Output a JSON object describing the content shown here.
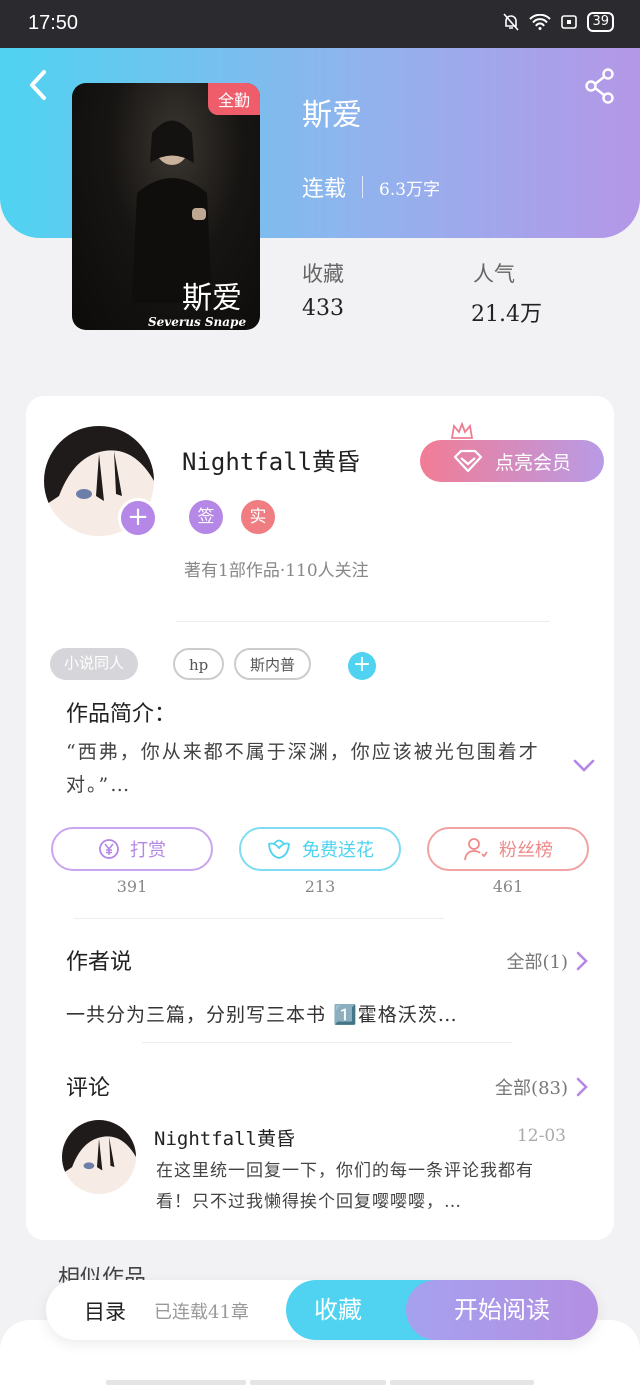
{
  "status_bar": {
    "time": "17:50",
    "battery": "39"
  },
  "book": {
    "cover_badge": "全勤",
    "cover_title": "斯爱",
    "cover_subtitle": "Severus Snape",
    "title": "斯爱",
    "status": "连载",
    "word_count": "6.3万字",
    "favorites_label": "收藏",
    "favorites_value": "433",
    "popularity_label": "人气",
    "popularity_value": "21.4万"
  },
  "author": {
    "name": "Nightfall黄昏",
    "vip_label": "点亮会员",
    "badge_sign": "签",
    "badge_real": "实",
    "description": "著有1部作品·110人关注"
  },
  "tags": [
    "小说同人",
    "hp",
    "斯内普"
  ],
  "intro": {
    "title": "作品简介：",
    "text": "“西弗，你从来都不属于深渊，你应该被光包围着才对。”…"
  },
  "actions": [
    {
      "label": "打赏",
      "count": "391",
      "color": "#b587e6"
    },
    {
      "label": "免费送花",
      "count": "213",
      "color": "#4fd3f0"
    },
    {
      "label": "粉丝榜",
      "count": "461",
      "color": "#ef8a8a"
    }
  ],
  "author_says": {
    "title": "作者说",
    "more": "全部(1)",
    "text": "一共分为三篇，分别写三本书 1️⃣霍格沃茨…"
  },
  "comments": {
    "title": "评论",
    "more": "全部(83)",
    "items": [
      {
        "name": "Nightfall黄昏",
        "date": "12-03",
        "text": "在这里统一回复一下，你们的每一条评论我都有看！只不过我懒得挨个回复嘤嘤嘤，…"
      }
    ]
  },
  "similar_title": "相似作品",
  "bottom_bar": {
    "toc": "目录",
    "chapters": "已连载41章",
    "collect": "收藏",
    "read": "开始阅读"
  },
  "colors": {
    "accent_cyan": "#4fd3f0",
    "accent_purple": "#b587e6",
    "accent_red": "#ef5d6b"
  }
}
